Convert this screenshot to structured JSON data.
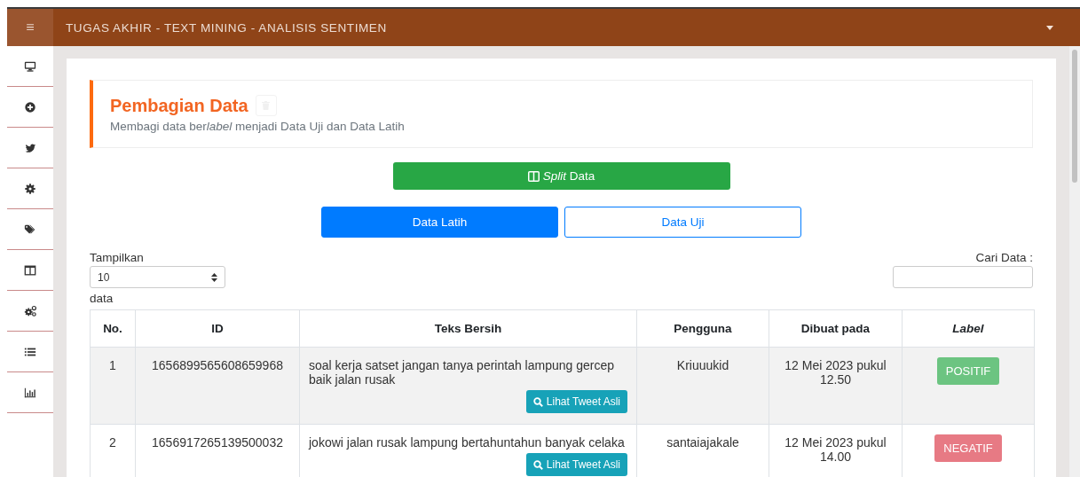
{
  "navbar": {
    "menu_icon": "≡",
    "title": "TUGAS AKHIR - TEXT MINING - ANALISIS SENTIMEN"
  },
  "sidebar": {
    "items": [
      {
        "kind": "monitor"
      },
      {
        "kind": "plus"
      },
      {
        "kind": "bird"
      },
      {
        "kind": "gear"
      },
      {
        "kind": "tags"
      },
      {
        "kind": "columns"
      },
      {
        "kind": "gears"
      },
      {
        "kind": "list"
      },
      {
        "kind": "chart"
      }
    ]
  },
  "callout": {
    "title": "Pembagian Data",
    "description": {
      "before": "Membagi data ber",
      "emphasis": "label",
      "after": " menjadi Data Uji dan Data Latih"
    }
  },
  "split_button": {
    "label": "*Split* Data"
  },
  "tabs": [
    {
      "label": "Data Latih",
      "selected": true
    },
    {
      "label": "Data Uji",
      "selected": false
    }
  ],
  "length_control": {
    "label_before": "Tampilkan",
    "value": "10",
    "label_after": "data"
  },
  "search": {
    "label": "Cari Data :"
  },
  "table": {
    "columns": [
      {
        "label": "No.",
        "italic": false
      },
      {
        "label": "ID",
        "italic": false
      },
      {
        "label": "Teks Bersih",
        "italic": false
      },
      {
        "label": "Pengguna",
        "italic": false
      },
      {
        "label": "Dibuat pada",
        "italic": false
      },
      {
        "label": "Label",
        "italic": true
      }
    ],
    "rows": [
      {
        "no": "1",
        "id": "1656899565608659968",
        "text": "soal kerja satset jangan tanya perintah lampung gercep baik jalan rusak",
        "button": "Lihat Tweet Asli",
        "user": "Kriuuukid",
        "created": "12 Mei 2023 pukul 12.50",
        "label": {
          "text": "POSITIF",
          "kind": "positive"
        }
      },
      {
        "no": "2",
        "id": "1656917265139500032",
        "text": "jokowi jalan rusak lampung bertahuntahun banyak celaka",
        "button": "Lihat Tweet Asli",
        "user": "santaiajakale",
        "created": "12 Mei 2023 pukul 14.00",
        "label": {
          "text": "NEGATIF",
          "kind": "negative"
        }
      }
    ]
  }
}
